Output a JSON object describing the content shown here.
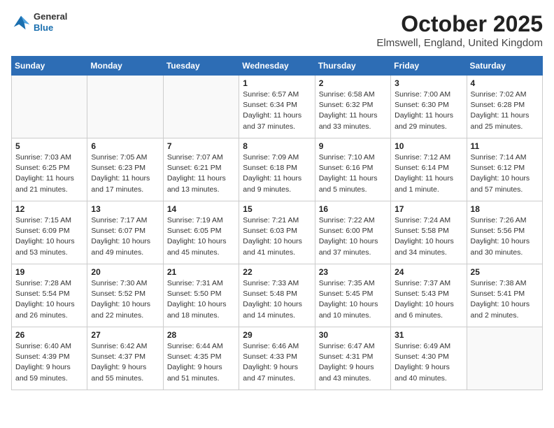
{
  "header": {
    "logo": {
      "general": "General",
      "blue": "Blue"
    },
    "title": "October 2025",
    "subtitle": "Elmswell, England, United Kingdom"
  },
  "weekdays": [
    "Sunday",
    "Monday",
    "Tuesday",
    "Wednesday",
    "Thursday",
    "Friday",
    "Saturday"
  ],
  "weeks": [
    [
      {
        "day": "",
        "info": ""
      },
      {
        "day": "",
        "info": ""
      },
      {
        "day": "",
        "info": ""
      },
      {
        "day": "1",
        "info": "Sunrise: 6:57 AM\nSunset: 6:34 PM\nDaylight: 11 hours\nand 37 minutes."
      },
      {
        "day": "2",
        "info": "Sunrise: 6:58 AM\nSunset: 6:32 PM\nDaylight: 11 hours\nand 33 minutes."
      },
      {
        "day": "3",
        "info": "Sunrise: 7:00 AM\nSunset: 6:30 PM\nDaylight: 11 hours\nand 29 minutes."
      },
      {
        "day": "4",
        "info": "Sunrise: 7:02 AM\nSunset: 6:28 PM\nDaylight: 11 hours\nand 25 minutes."
      }
    ],
    [
      {
        "day": "5",
        "info": "Sunrise: 7:03 AM\nSunset: 6:25 PM\nDaylight: 11 hours\nand 21 minutes."
      },
      {
        "day": "6",
        "info": "Sunrise: 7:05 AM\nSunset: 6:23 PM\nDaylight: 11 hours\nand 17 minutes."
      },
      {
        "day": "7",
        "info": "Sunrise: 7:07 AM\nSunset: 6:21 PM\nDaylight: 11 hours\nand 13 minutes."
      },
      {
        "day": "8",
        "info": "Sunrise: 7:09 AM\nSunset: 6:18 PM\nDaylight: 11 hours\nand 9 minutes."
      },
      {
        "day": "9",
        "info": "Sunrise: 7:10 AM\nSunset: 6:16 PM\nDaylight: 11 hours\nand 5 minutes."
      },
      {
        "day": "10",
        "info": "Sunrise: 7:12 AM\nSunset: 6:14 PM\nDaylight: 11 hours\nand 1 minute."
      },
      {
        "day": "11",
        "info": "Sunrise: 7:14 AM\nSunset: 6:12 PM\nDaylight: 10 hours\nand 57 minutes."
      }
    ],
    [
      {
        "day": "12",
        "info": "Sunrise: 7:15 AM\nSunset: 6:09 PM\nDaylight: 10 hours\nand 53 minutes."
      },
      {
        "day": "13",
        "info": "Sunrise: 7:17 AM\nSunset: 6:07 PM\nDaylight: 10 hours\nand 49 minutes."
      },
      {
        "day": "14",
        "info": "Sunrise: 7:19 AM\nSunset: 6:05 PM\nDaylight: 10 hours\nand 45 minutes."
      },
      {
        "day": "15",
        "info": "Sunrise: 7:21 AM\nSunset: 6:03 PM\nDaylight: 10 hours\nand 41 minutes."
      },
      {
        "day": "16",
        "info": "Sunrise: 7:22 AM\nSunset: 6:00 PM\nDaylight: 10 hours\nand 37 minutes."
      },
      {
        "day": "17",
        "info": "Sunrise: 7:24 AM\nSunset: 5:58 PM\nDaylight: 10 hours\nand 34 minutes."
      },
      {
        "day": "18",
        "info": "Sunrise: 7:26 AM\nSunset: 5:56 PM\nDaylight: 10 hours\nand 30 minutes."
      }
    ],
    [
      {
        "day": "19",
        "info": "Sunrise: 7:28 AM\nSunset: 5:54 PM\nDaylight: 10 hours\nand 26 minutes."
      },
      {
        "day": "20",
        "info": "Sunrise: 7:30 AM\nSunset: 5:52 PM\nDaylight: 10 hours\nand 22 minutes."
      },
      {
        "day": "21",
        "info": "Sunrise: 7:31 AM\nSunset: 5:50 PM\nDaylight: 10 hours\nand 18 minutes."
      },
      {
        "day": "22",
        "info": "Sunrise: 7:33 AM\nSunset: 5:48 PM\nDaylight: 10 hours\nand 14 minutes."
      },
      {
        "day": "23",
        "info": "Sunrise: 7:35 AM\nSunset: 5:45 PM\nDaylight: 10 hours\nand 10 minutes."
      },
      {
        "day": "24",
        "info": "Sunrise: 7:37 AM\nSunset: 5:43 PM\nDaylight: 10 hours\nand 6 minutes."
      },
      {
        "day": "25",
        "info": "Sunrise: 7:38 AM\nSunset: 5:41 PM\nDaylight: 10 hours\nand 2 minutes."
      }
    ],
    [
      {
        "day": "26",
        "info": "Sunrise: 6:40 AM\nSunset: 4:39 PM\nDaylight: 9 hours\nand 59 minutes."
      },
      {
        "day": "27",
        "info": "Sunrise: 6:42 AM\nSunset: 4:37 PM\nDaylight: 9 hours\nand 55 minutes."
      },
      {
        "day": "28",
        "info": "Sunrise: 6:44 AM\nSunset: 4:35 PM\nDaylight: 9 hours\nand 51 minutes."
      },
      {
        "day": "29",
        "info": "Sunrise: 6:46 AM\nSunset: 4:33 PM\nDaylight: 9 hours\nand 47 minutes."
      },
      {
        "day": "30",
        "info": "Sunrise: 6:47 AM\nSunset: 4:31 PM\nDaylight: 9 hours\nand 43 minutes."
      },
      {
        "day": "31",
        "info": "Sunrise: 6:49 AM\nSunset: 4:30 PM\nDaylight: 9 hours\nand 40 minutes."
      },
      {
        "day": "",
        "info": ""
      }
    ]
  ]
}
